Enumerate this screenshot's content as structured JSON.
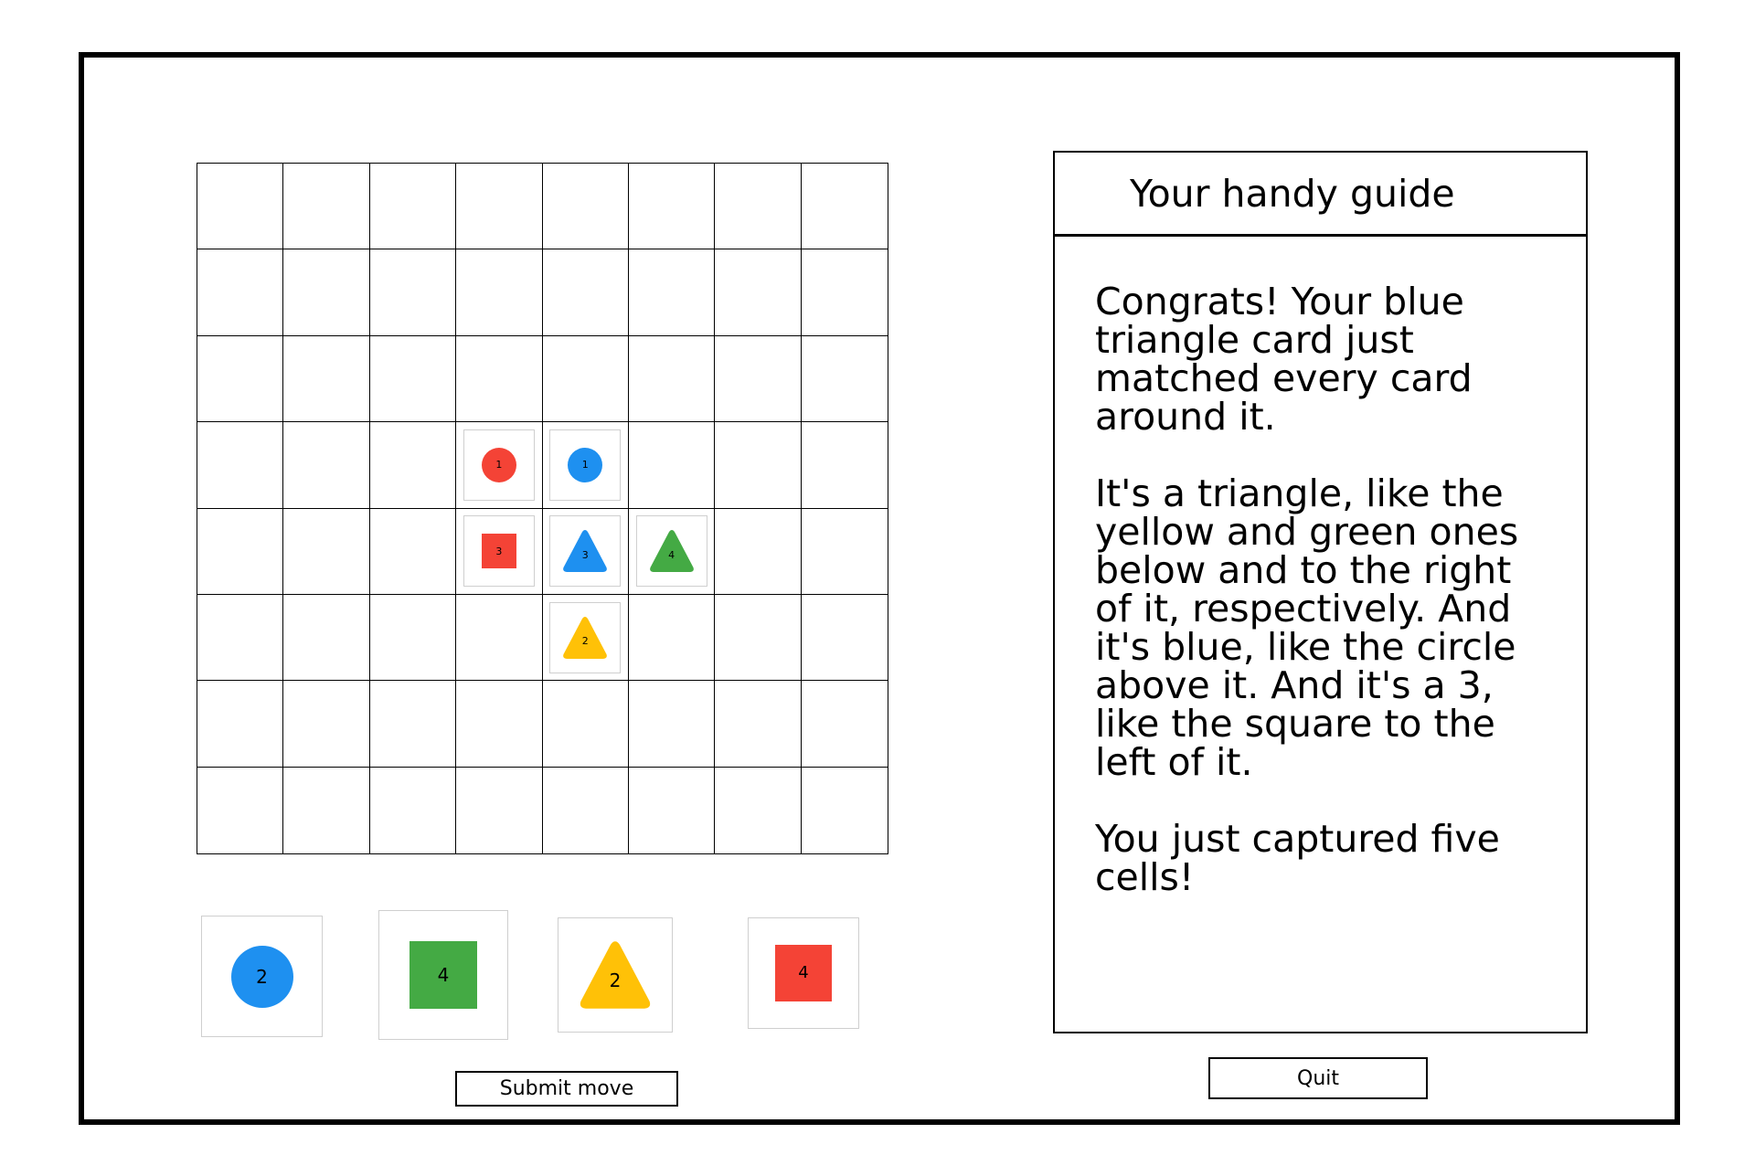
{
  "colors": {
    "red": "#f44336",
    "blue": "#1e90f0",
    "green": "#44aa44",
    "yellow": "#ffc107",
    "card_border": "#cfcfcf"
  },
  "board": {
    "rows": 8,
    "cols": 8,
    "cards": [
      {
        "row": 3,
        "col": 3,
        "shape": "circle",
        "color": "red",
        "number": "1"
      },
      {
        "row": 3,
        "col": 4,
        "shape": "circle",
        "color": "blue",
        "number": "1"
      },
      {
        "row": 4,
        "col": 3,
        "shape": "square",
        "color": "red",
        "number": "3"
      },
      {
        "row": 4,
        "col": 4,
        "shape": "triangle",
        "color": "blue",
        "number": "3"
      },
      {
        "row": 4,
        "col": 5,
        "shape": "triangle",
        "color": "green",
        "number": "4"
      },
      {
        "row": 5,
        "col": 4,
        "shape": "triangle",
        "color": "yellow",
        "number": "2"
      }
    ]
  },
  "hand": [
    {
      "shape": "circle",
      "color": "blue",
      "number": "2"
    },
    {
      "shape": "square",
      "color": "green",
      "number": "4"
    },
    {
      "shape": "triangle",
      "color": "yellow",
      "number": "2"
    },
    {
      "shape": "square",
      "color": "red",
      "number": "4"
    }
  ],
  "buttons": {
    "submit": "Submit move",
    "quit": "Quit"
  },
  "guide": {
    "title": "Your handy guide",
    "paragraphs": [
      "Congrats! Your blue triangle card just matched every card around it.",
      "It's a triangle, like the yellow and green ones below and to the right of it, respectively. And it's blue, like the circle above it. And it's a 3, like the square to the left of it.",
      "You just captured five cells!"
    ]
  }
}
